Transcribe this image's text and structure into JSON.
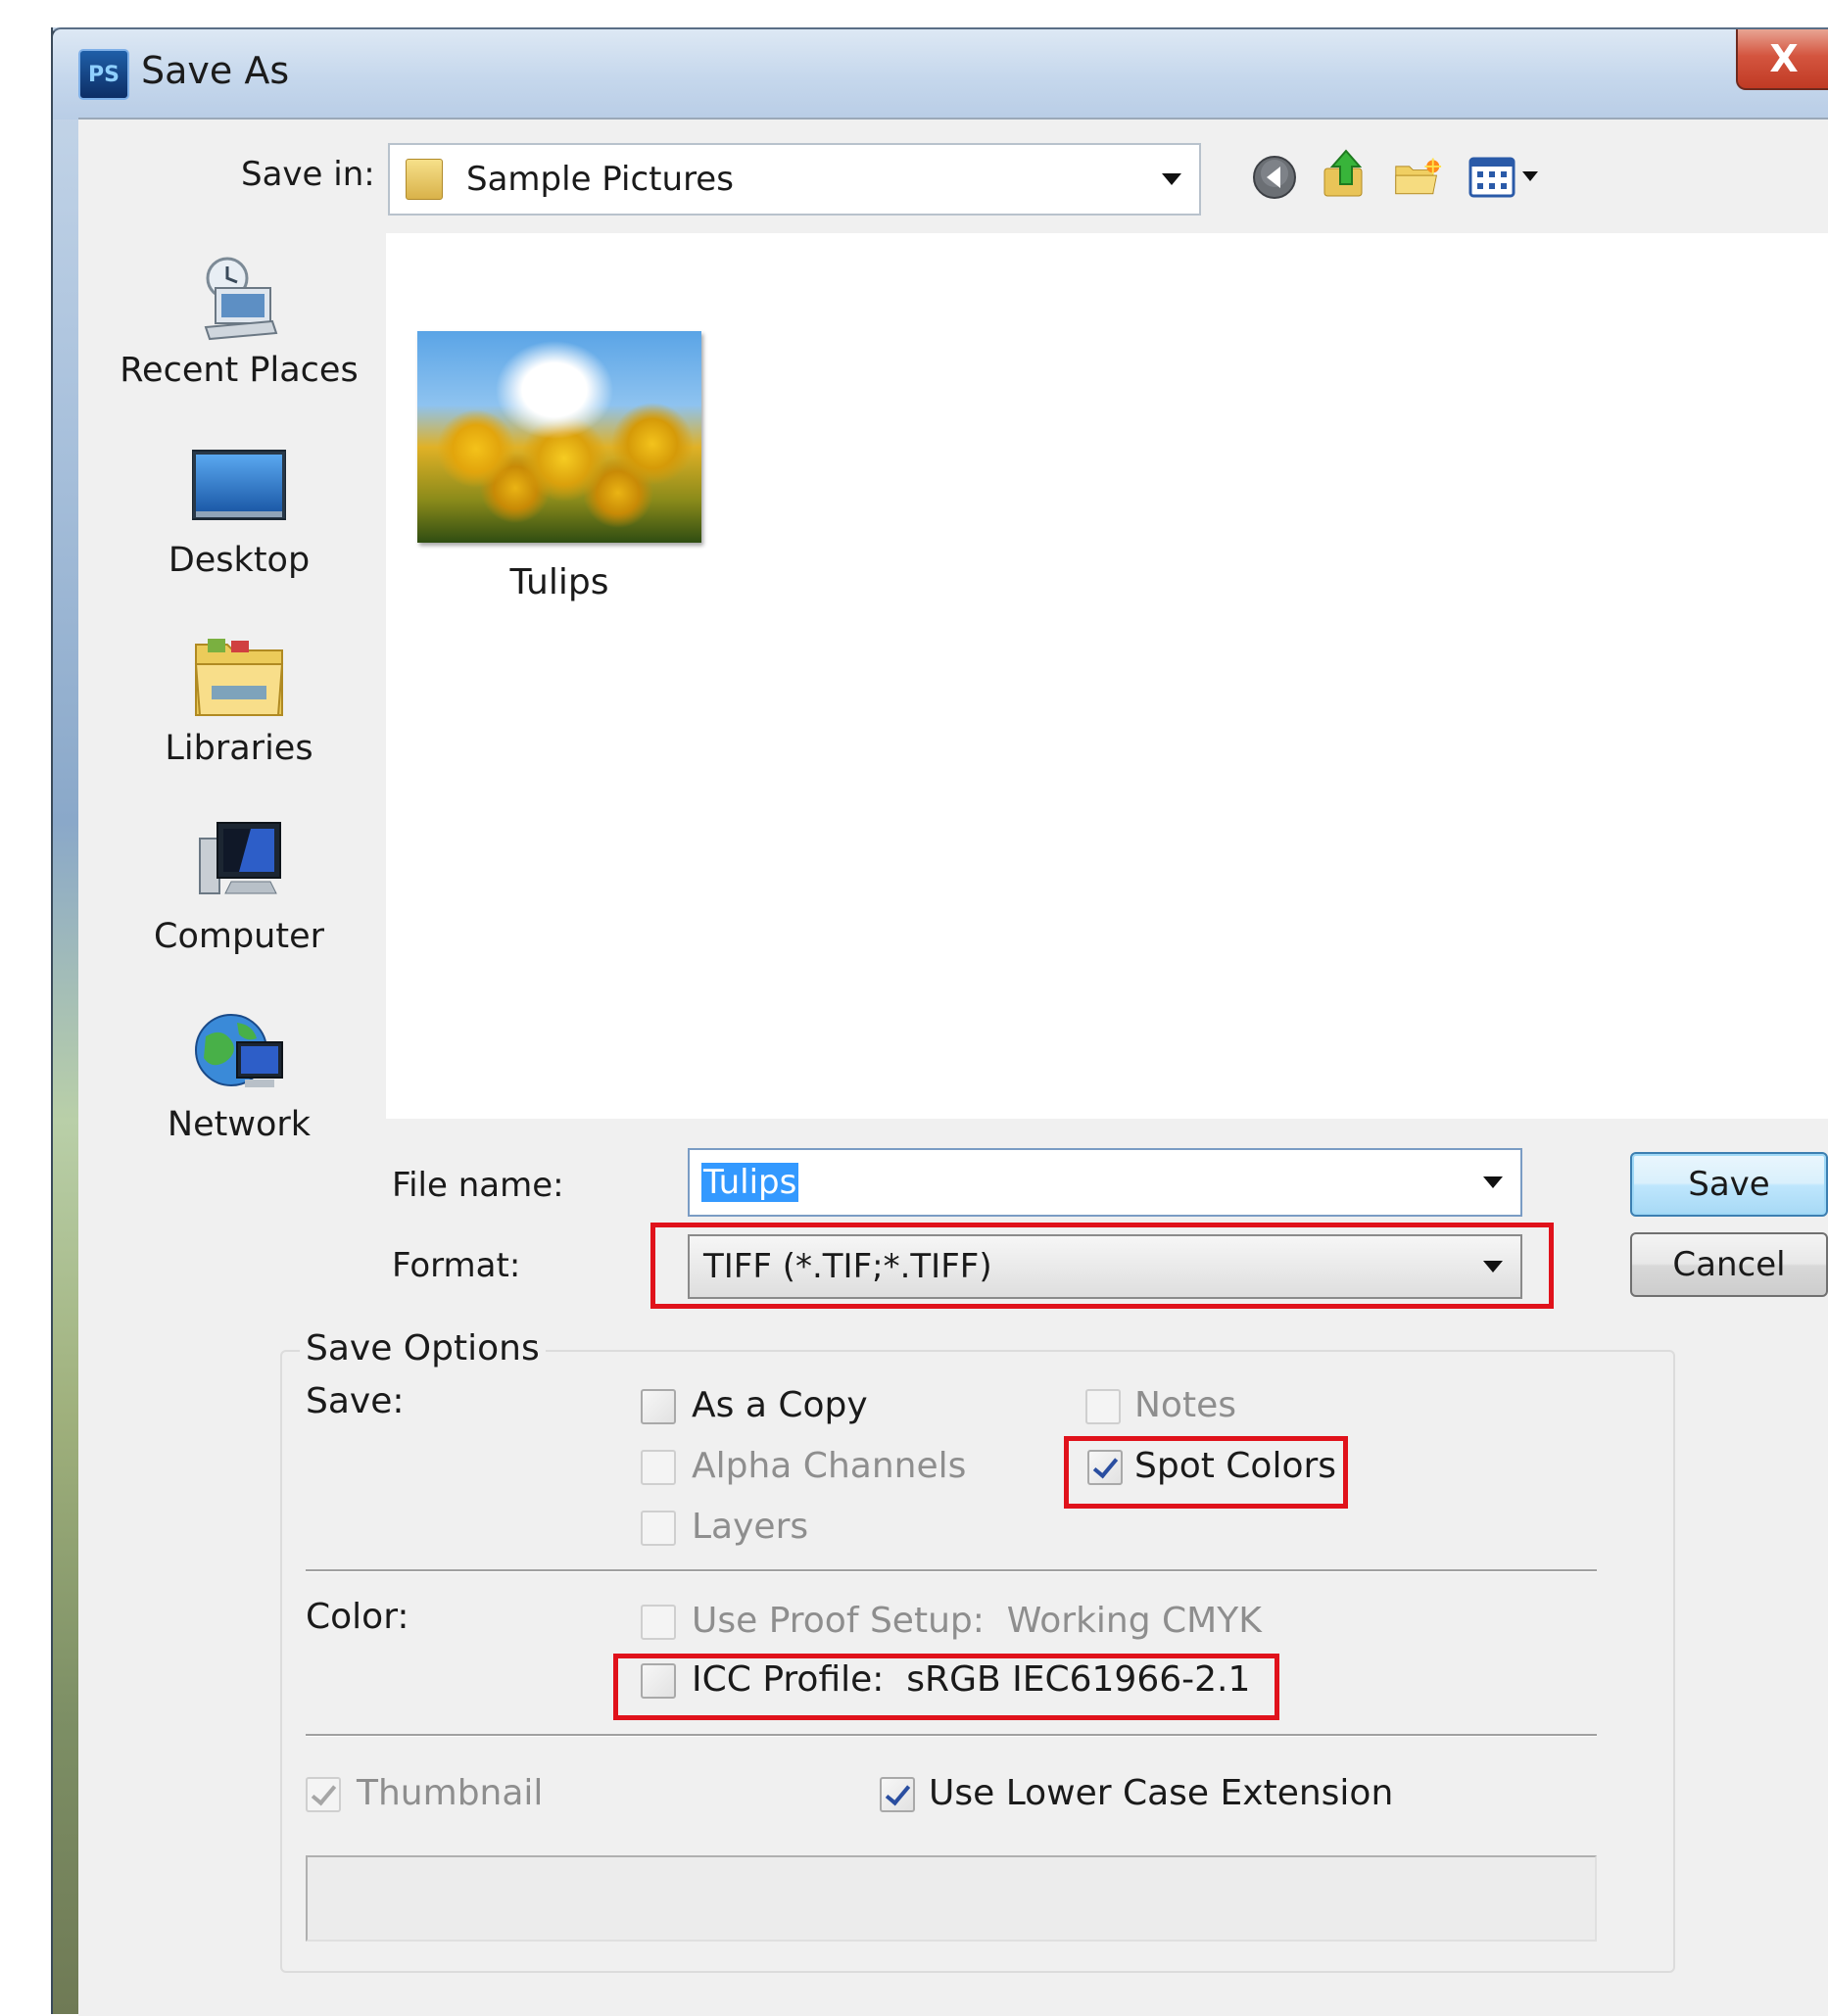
{
  "window": {
    "title": "Save As",
    "app_icon": "PS",
    "close_glyph": "X"
  },
  "save_in": {
    "label": "Save in:",
    "value": "Sample Pictures"
  },
  "toolbar": {
    "icons": [
      "back-icon",
      "up-folder-icon",
      "new-folder-icon",
      "view-menu-icon"
    ]
  },
  "places": [
    {
      "label": "Recent Places",
      "icon": "recent-places-icon"
    },
    {
      "label": "Desktop",
      "icon": "desktop-icon"
    },
    {
      "label": "Libraries",
      "icon": "libraries-icon"
    },
    {
      "label": "Computer",
      "icon": "computer-icon"
    },
    {
      "label": "Network",
      "icon": "network-icon"
    }
  ],
  "files": [
    {
      "name": "Tulips"
    }
  ],
  "file_name": {
    "label": "File name:",
    "value": "Tulips"
  },
  "format": {
    "label": "Format:",
    "value": "TIFF (*.TIF;*.TIFF)"
  },
  "buttons": {
    "save": "Save",
    "cancel": "Cancel"
  },
  "save_options": {
    "group_title": "Save Options",
    "save_label": "Save:",
    "as_a_copy": {
      "label": "As a Copy",
      "checked": false,
      "enabled": true
    },
    "notes": {
      "label": "Notes",
      "checked": false,
      "enabled": false
    },
    "alpha_channels": {
      "label": "Alpha Channels",
      "checked": false,
      "enabled": false
    },
    "spot_colors": {
      "label": "Spot Colors",
      "checked": true,
      "enabled": true
    },
    "layers": {
      "label": "Layers",
      "checked": false,
      "enabled": false
    },
    "color_label": "Color:",
    "use_proof_setup": {
      "label": "Use Proof Setup:",
      "value": "Working CMYK",
      "checked": false,
      "enabled": false
    },
    "icc_profile": {
      "label": "ICC Profile:",
      "value": "sRGB IEC61966-2.1",
      "checked": false,
      "enabled": true
    },
    "thumbnail": {
      "label": "Thumbnail",
      "checked": true,
      "enabled": false
    },
    "use_lower_case_extension": {
      "label": "Use Lower Case Extension",
      "checked": true,
      "enabled": true
    }
  },
  "colors": {
    "highlight": "#e0121b",
    "selection": "#3399ff"
  }
}
